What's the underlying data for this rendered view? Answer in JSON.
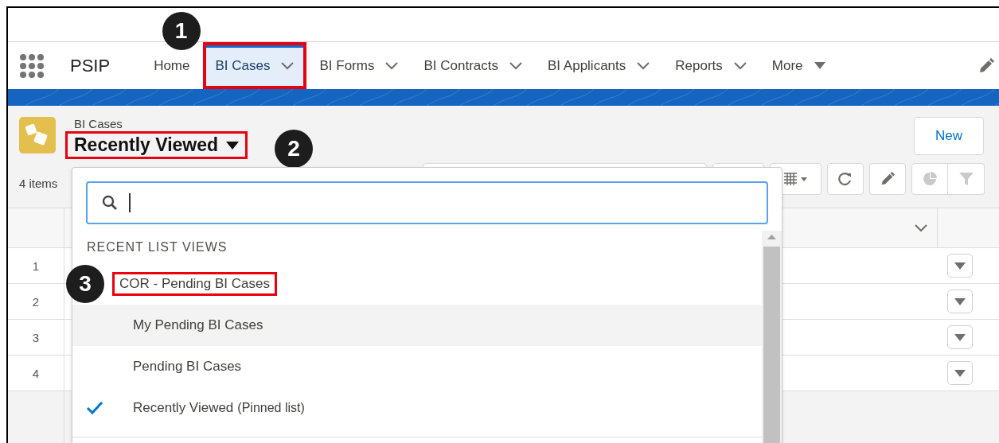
{
  "top_nav": {
    "app_name": "PSIP",
    "tabs": [
      {
        "label": "Home",
        "kind": "link",
        "selected": false,
        "highlighted": false
      },
      {
        "label": "BI Cases",
        "kind": "menu",
        "selected": true,
        "highlighted": true,
        "callout": "1"
      },
      {
        "label": "BI Forms",
        "kind": "menu",
        "selected": false,
        "highlighted": false
      },
      {
        "label": "BI Contracts",
        "kind": "menu",
        "selected": false,
        "highlighted": false
      },
      {
        "label": "BI Applicants",
        "kind": "menu",
        "selected": false,
        "highlighted": false
      },
      {
        "label": "Reports",
        "kind": "menu",
        "selected": false,
        "highlighted": false
      },
      {
        "label": "More",
        "kind": "overflow",
        "selected": false,
        "highlighted": false
      }
    ]
  },
  "list_header": {
    "object_label": "BI Cases",
    "list_view": "Recently Viewed",
    "highlighted": true,
    "callout": "2",
    "new_button": "New",
    "item_count": "4 items"
  },
  "table": {
    "rows": [
      {
        "number": "1"
      },
      {
        "number": "2"
      },
      {
        "number": "3"
      },
      {
        "number": "4"
      }
    ]
  },
  "list_view_menu": {
    "section_heading": "RECENT LIST VIEWS",
    "items": [
      {
        "label": "COR - Pending BI Cases",
        "checked": false,
        "hovered": false,
        "highlighted": true,
        "callout": "3"
      },
      {
        "label": "My Pending BI Cases",
        "checked": false,
        "hovered": true,
        "highlighted": false
      },
      {
        "label": "Pending BI Cases",
        "checked": false,
        "hovered": false,
        "highlighted": false
      },
      {
        "label": "Recently Viewed",
        "note": "(Pinned list)",
        "checked": true,
        "hovered": false,
        "highlighted": false
      }
    ]
  }
}
